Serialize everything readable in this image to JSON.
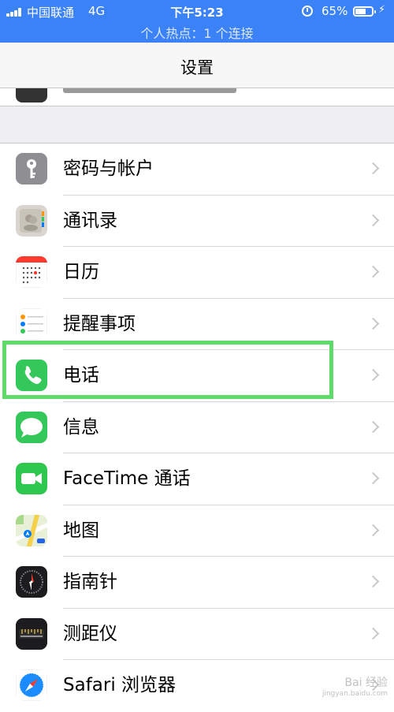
{
  "status_bar": {
    "carrier": "中国联通",
    "network": "4G",
    "time": "下午5:23",
    "battery_percent": "65%",
    "battery_level": 0.65,
    "hotspot": "个人热点：1 个连接"
  },
  "nav": {
    "title": "设置"
  },
  "rows": [
    {
      "label": "密码与帐户",
      "icon": "key-icon"
    },
    {
      "label": "通讯录",
      "icon": "contacts-icon"
    },
    {
      "label": "日历",
      "icon": "calendar-icon"
    },
    {
      "label": "提醒事项",
      "icon": "reminders-icon"
    },
    {
      "label": "电话",
      "icon": "phone-icon"
    },
    {
      "label": "信息",
      "icon": "messages-icon"
    },
    {
      "label": "FaceTime 通话",
      "icon": "facetime-icon"
    },
    {
      "label": "地图",
      "icon": "maps-icon"
    },
    {
      "label": "指南针",
      "icon": "compass-icon"
    },
    {
      "label": "测距仪",
      "icon": "measure-icon"
    },
    {
      "label": "Safari 浏览器",
      "icon": "safari-icon"
    }
  ],
  "highlighted_row": "电话",
  "watermark": {
    "text": "Bai 经验",
    "sub": "jingyan.baidu.com"
  },
  "colors": {
    "status_bar": "#3b82f6",
    "highlight": "#5ddb6b",
    "phone_green": "#34c759",
    "facetime_green": "#2fc84f"
  }
}
